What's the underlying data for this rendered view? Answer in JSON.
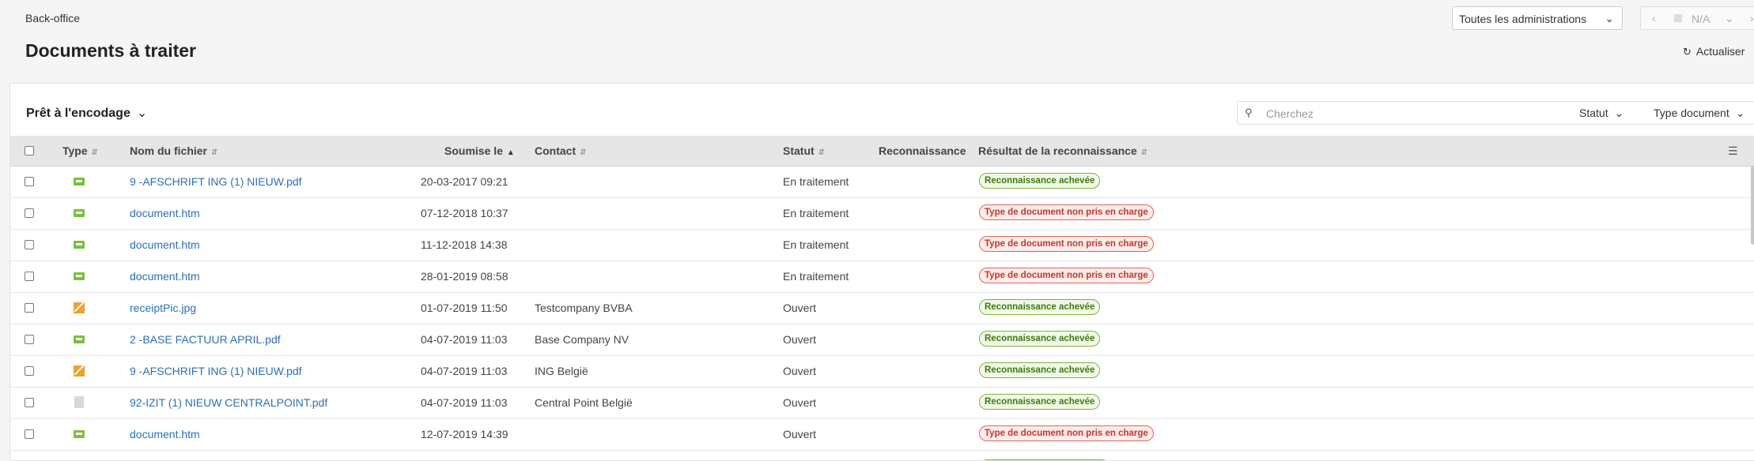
{
  "header": {
    "breadcrumb": "Back-office",
    "title": "Documents à traiter",
    "admin_select": "Toutes les administrations",
    "pager_value": "N/A",
    "refresh_label": "Actualiser"
  },
  "toolbar": {
    "filter_title": "Prêt à l'encodage",
    "search_placeholder": "Cherchez",
    "filter_status": "Statut",
    "filter_doctype": "Type document"
  },
  "table": {
    "columns": {
      "type": "Type",
      "filename": "Nom du fichier",
      "submitted": "Soumise le",
      "contact": "Contact",
      "status": "Statut",
      "recognition": "Reconnaissance",
      "result": "Résultat de la reconnaissance"
    },
    "rows": [
      {
        "icon": "id-card-icon",
        "filename": "9 -AFSCHRIFT ING (1) NIEUW.pdf",
        "date": "20-03-2017 09:21",
        "contact": "",
        "status": "En traitement",
        "result": "Reconnaissance achevée",
        "result_type": "ok"
      },
      {
        "icon": "green-file-icon",
        "filename": "document.htm",
        "date": "07-12-2018 10:37",
        "contact": "",
        "status": "En traitement",
        "result": "Type de document non pris en charge",
        "result_type": "err"
      },
      {
        "icon": "green-file-icon",
        "filename": "document.htm",
        "date": "11-12-2018 14:38",
        "contact": "",
        "status": "En traitement",
        "result": "Type de document non pris en charge",
        "result_type": "err"
      },
      {
        "icon": "green-file-icon",
        "filename": "document.htm",
        "date": "28-01-2019 08:58",
        "contact": "",
        "status": "En traitement",
        "result": "Type de document non pris en charge",
        "result_type": "err"
      },
      {
        "icon": "orange-file-icon",
        "filename": "receiptPic.jpg",
        "date": "01-07-2019 11:50",
        "contact": "Testcompany BVBA",
        "status": "Ouvert",
        "result": "Reconnaissance achevée",
        "result_type": "ok"
      },
      {
        "icon": "green-file-icon",
        "filename": "2 -BASE FACTUUR APRIL.pdf",
        "date": "04-07-2019 11:03",
        "contact": "Base Company NV",
        "status": "Ouvert",
        "result": "Reconnaissance achevée",
        "result_type": "ok"
      },
      {
        "icon": "orange-file-icon",
        "filename": "9 -AFSCHRIFT ING (1) NIEUW.pdf",
        "date": "04-07-2019 11:03",
        "contact": "ING België",
        "status": "Ouvert",
        "result": "Reconnaissance achevée",
        "result_type": "ok"
      },
      {
        "icon": "grey-file-icon",
        "filename": "92-IZIT (1) NIEUW CENTRALPOINT.pdf",
        "date": "04-07-2019 11:03",
        "contact": "Central Point België",
        "status": "Ouvert",
        "result": "Reconnaissance achevée",
        "result_type": "ok"
      },
      {
        "icon": "green-file-icon",
        "filename": "document.htm",
        "date": "12-07-2019 14:39",
        "contact": "",
        "status": "Ouvert",
        "result": "Type de document non pris en charge",
        "result_type": "err"
      }
    ]
  },
  "colors": {
    "link": "#2c6fb7",
    "ok_badge": "#7cb342",
    "err_badge": "#e06555",
    "header_bg": "#e6e6e6"
  }
}
